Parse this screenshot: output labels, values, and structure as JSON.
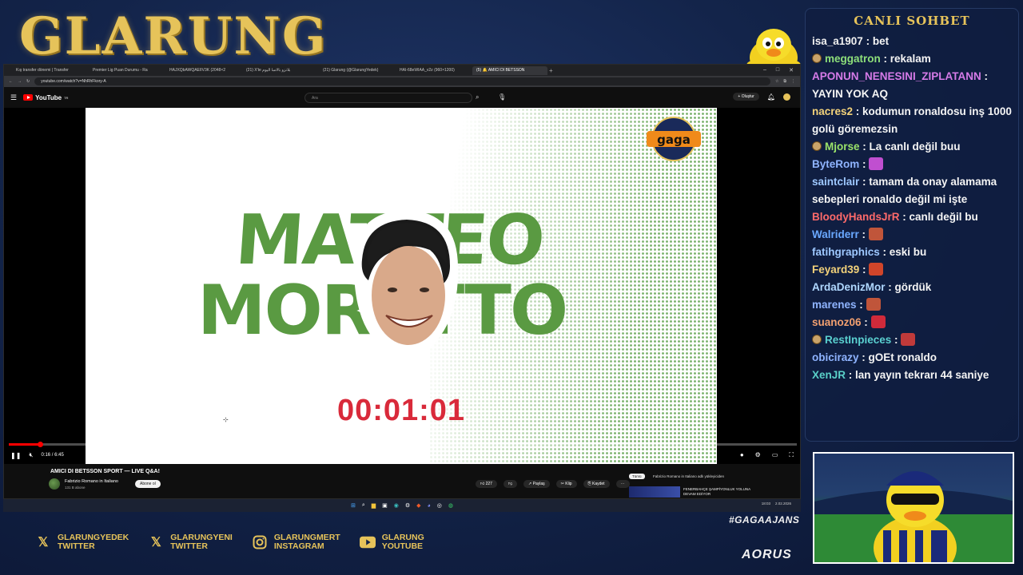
{
  "overlay": {
    "brand": "GLARUNG",
    "hashtag": "#GAGAAJANS",
    "sponsor": "AORUS",
    "socials": [
      {
        "icon": "x-icon",
        "line1": "GLARUNGYEDEK",
        "line2": "TWITTER"
      },
      {
        "icon": "x-icon",
        "line1": "GLARUNGYENI",
        "line2": "TWITTER"
      },
      {
        "icon": "instagram-icon",
        "line1": "GLARUNGMERT",
        "line2": "INSTAGRAM"
      },
      {
        "icon": "youtube-icon",
        "line1": "GLARUNG",
        "line2": "YOUTUBE"
      }
    ],
    "colors": {
      "gold": "#e6c35a",
      "navy": "#13244a"
    }
  },
  "browser": {
    "tabs": [
      {
        "label": "Kış transfer dönemi | Transfer"
      },
      {
        "label": "Premier Lig Puan Durumu - Ra"
      },
      {
        "label": "HAJXQbAWQAEIIV3K (2048×2"
      },
      {
        "label": "(21) X'te بلانزو بالاسا اليوم"
      },
      {
        "label": "(21) Glarung (@GlarungYedek)"
      },
      {
        "label": "HAI-68eWIAA_v2z (960×1200)"
      },
      {
        "label": "(5) 🔔 AMICI DI BETSSON"
      }
    ],
    "url": "youtube.com/watch?v=NhRhFkory-A"
  },
  "youtube": {
    "logo": "YouTube",
    "country": "TR",
    "search_placeholder": "Ara",
    "create_label": "Oluştur",
    "video": {
      "overlay_name_line1": "MATTEO",
      "overlay_name_line2": "MORETTO",
      "badge": "gaga",
      "countdown": "00:01:01",
      "time": "0:16 / 6:45",
      "progress": 0.04
    },
    "title": "AMICI DI BETSSON SPORT — LIVE Q&A!",
    "channel": "Fabrizio Romano in Italiano",
    "subscribers": "131 B abone",
    "subscribe_label": "Abone ol",
    "actions": {
      "likes": "227",
      "share": "Paylaş",
      "clip": "Klip",
      "save": "Kaydet"
    },
    "filter_all": "Tümü",
    "filter_channel": "Fabrizio Romano in Italiano adlı yükleyiciden",
    "rec_title": "FENERBAHÇE ŞAMPİYONLUK YOLUNA DEVAM EDİYOR"
  },
  "taskbar": {
    "time": "18:03",
    "date": "2.02.2026"
  },
  "chat": {
    "title": "CANLI SOHBET",
    "messages": [
      {
        "user": "isa_a1907",
        "color": "#f1f1f1",
        "text": "bet",
        "badge": false,
        "emote": ""
      },
      {
        "user": "meggatron",
        "color": "#8ee07a",
        "text": "rekalam",
        "badge": true,
        "emote": ""
      },
      {
        "user": "APONUN_NENESINI_ZIPLATANN",
        "color": "#d67be8",
        "text": "YAYIN YOK AQ",
        "badge": false,
        "emote": ""
      },
      {
        "user": "nacres2",
        "color": "#f3d27a",
        "text": "kodumun ronaldosu inş 1000 golü göremezsin",
        "badge": false,
        "emote": ""
      },
      {
        "user": "Mjorse",
        "color": "#9be36a",
        "text": "La canlı değil buu",
        "badge": true,
        "emote": ""
      },
      {
        "user": "ByteRom",
        "color": "#8fb4ff",
        "text": "",
        "badge": false,
        "emote": "#c04fd0"
      },
      {
        "user": "saintclair",
        "color": "#9ec8ff",
        "text": "tamam da onay alamama sebepleri ronaldo değil mi işte",
        "badge": false,
        "emote": ""
      },
      {
        "user": "BloodyHandsJrR",
        "color": "#ff6a6a",
        "text": "canlı değil bu",
        "badge": false,
        "emote": ""
      },
      {
        "user": "Walriderr",
        "color": "#6aa8ff",
        "text": "",
        "badge": false,
        "emote": "#c0553a"
      },
      {
        "user": "fatihgraphics",
        "color": "#9ec8ff",
        "text": "eski bu",
        "badge": false,
        "emote": ""
      },
      {
        "user": "Feyard39",
        "color": "#f3d27a",
        "text": "",
        "badge": false,
        "emote": "#d0452a"
      },
      {
        "user": "ArdaDenizMor",
        "color": "#b0d8ff",
        "text": "gördük",
        "badge": false,
        "emote": ""
      },
      {
        "user": "marenes",
        "color": "#8fb4ff",
        "text": "",
        "badge": false,
        "emote": "#c0553a"
      },
      {
        "user": "suanoz06",
        "color": "#f3a070",
        "text": "",
        "badge": false,
        "emote": "#d02a3a"
      },
      {
        "user": "RestInpieces",
        "color": "#5ad0d0",
        "text": "",
        "badge": true,
        "emote": "#c03a3a"
      },
      {
        "user": "obicirazy",
        "color": "#8fb4ff",
        "text": "gOEt ronaldo",
        "badge": false,
        "emote": ""
      },
      {
        "user": "XenJR",
        "color": "#5ad0c8",
        "text": "lan yayın tekrarı 44 saniye",
        "badge": false,
        "emote": ""
      }
    ]
  }
}
